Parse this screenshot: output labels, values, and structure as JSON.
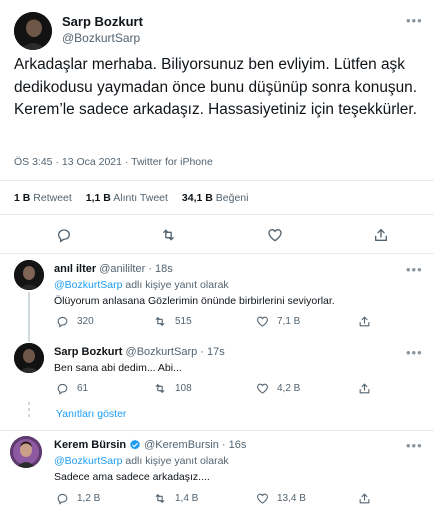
{
  "main_tweet": {
    "author_name": "Sarp Bozkurt",
    "author_handle": "@BozkurtSarp",
    "text": "Arkadaşlar merhaba. Biliyorsunuz ben evliyim. Lütfen aşk dedikodusu yaymadan önce bunu düşünüp sonra konuşun. Kerem’le sadece arkadaşız. Hassasiyetiniz için teşekkürler.",
    "meta": "ÖS 3:45 · 13 Oca 2021 · Twitter for iPhone",
    "stats": {
      "retweets_value": "1 B",
      "retweets_label": "Retweet",
      "quotes_value": "1,1 B",
      "quotes_label": "Alıntı Tweet",
      "likes_value": "34,1 B",
      "likes_label": "Beğeni"
    }
  },
  "replies": [
    {
      "name": "anıl ilter",
      "handle": "@anililter",
      "time": "· 18s",
      "reply_to_handle": "@BozkurtSarp",
      "reply_to_suffix": "adlı kişiye yanıt olarak",
      "text": "Ölüyorum anlasana Gözlerimin önünde birbirlerini seviyorlar.",
      "replies": "320",
      "retweets": "515",
      "likes": "7,1 B"
    },
    {
      "name": "Sarp Bozkurt",
      "handle": "@BozkurtSarp",
      "time": "· 17s",
      "text": "Ben sana abi dedim... Abi...",
      "replies": "61",
      "retweets": "108",
      "likes": "4,2 B",
      "show_replies": "Yanıtları göster"
    },
    {
      "name": "Kerem Bürsin",
      "handle": "@KeremBursin",
      "time": "· 16s",
      "reply_to_handle": "@BozkurtSarp",
      "reply_to_suffix": "adlı kişiye yanıt olarak",
      "text": "Sadece ama sadece arkadaşız....",
      "replies": "1,2 B",
      "retweets": "1,4 B",
      "likes": "13,4 B"
    }
  ],
  "icons": {
    "more": "more-icon",
    "reply": "reply-icon",
    "retweet": "retweet-icon",
    "like": "like-icon",
    "share": "share-icon",
    "verified": "verified-badge-icon"
  },
  "colors": {
    "accent": "#1d9bf0",
    "muted": "#536471",
    "divider": "#e6ecf0"
  }
}
